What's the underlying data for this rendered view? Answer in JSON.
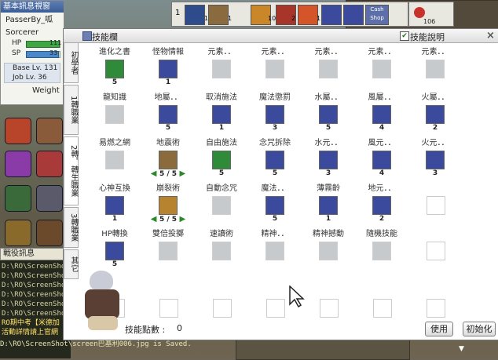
{
  "basic_window": {
    "title": "基本訊息視窗",
    "char_name": "PasserBy_呱",
    "job": "Sorcerer",
    "hp_label": "HP",
    "hp_value": "111",
    "hp_fraction": 0.97,
    "sp_label": "SP",
    "sp_value": "33",
    "sp_fraction": 0.95,
    "base_lv": "Base Lv. 131",
    "job_lv": "Job Lv. 36",
    "weight_label": "Weight :"
  },
  "hotbar": {
    "slot1_num": "1",
    "slot2_num": "1",
    "slot3_num": "10",
    "slot4_num": "2",
    "slot5_num": "1",
    "cash_shop_label": "Cash Shop",
    "potion_count": "106"
  },
  "chat": {
    "title": "戰役訊息",
    "lines": [
      "D:\\RO\\ScreenShot",
      "D:\\RO\\ScreenShot",
      "D:\\RO\\ScreenShot",
      "D:\\RO\\ScreenShot",
      "D:\\RO\\ScreenShot",
      "D:\\RO\\ScreenShot",
      "RO期中考【米德加",
      "活動詳情請上官網"
    ],
    "last_line": "D:\\RO\\ScreenShot\\screen巴基利006.jpg is Saved."
  },
  "skill_window": {
    "title": "技能欄",
    "desc_label": "技能說明",
    "close_label": "×",
    "tabs": [
      "初學者",
      "1轉職業",
      "2轉．轉生職業",
      "3轉職業",
      "其它"
    ],
    "rows": [
      [
        {
          "name": "進化之書",
          "lv": "5",
          "state": "learned",
          "color": "#2f8a3a"
        },
        {
          "name": "怪物情報",
          "lv": "1",
          "state": "learned",
          "color": "#3b4a9c"
        },
        {
          "name": "元素．．",
          "lv": "",
          "state": "locked",
          "color": "#9aa0a4"
        },
        {
          "name": "元素．．",
          "lv": "",
          "state": "locked",
          "color": "#9aa0a4"
        },
        {
          "name": "元素．．",
          "lv": "",
          "state": "locked",
          "color": "#9aa0a4"
        },
        {
          "name": "元素．．",
          "lv": "",
          "state": "locked",
          "color": "#9aa0a4"
        },
        {
          "name": "元素．．",
          "lv": "",
          "state": "locked",
          "color": "#9aa0a4"
        }
      ],
      [
        {
          "name": "龍知識",
          "lv": "",
          "state": "locked",
          "color": "#9aa0a4"
        },
        {
          "name": "地屬．．",
          "lv": "5",
          "state": "learned",
          "color": "#3b4a9c"
        },
        {
          "name": "取消施法",
          "lv": "1",
          "state": "learned",
          "color": "#3b4a9c"
        },
        {
          "name": "魔法懲罰",
          "lv": "3",
          "state": "learned",
          "color": "#3b4a9c"
        },
        {
          "name": "水屬．．",
          "lv": "5",
          "state": "learned",
          "color": "#3b4a9c"
        },
        {
          "name": "風屬．．",
          "lv": "4",
          "state": "learned",
          "color": "#3b4a9c"
        },
        {
          "name": "火屬．．",
          "lv": "2",
          "state": "learned",
          "color": "#3b4a9c"
        }
      ],
      [
        {
          "name": "易燃之網",
          "lv": "",
          "state": "locked",
          "color": "#9aa0a4"
        },
        {
          "name": "地震術",
          "lv": "5 / 5",
          "state": "stepper",
          "color": "#8b6a3c"
        },
        {
          "name": "自由施法",
          "lv": "5",
          "state": "learned",
          "color": "#2f8a3a"
        },
        {
          "name": "念咒拆除",
          "lv": "5",
          "state": "learned",
          "color": "#3b4a9c"
        },
        {
          "name": "水元．．",
          "lv": "3",
          "state": "learned",
          "color": "#3b4a9c"
        },
        {
          "name": "風元．．",
          "lv": "4",
          "state": "learned",
          "color": "#3b4a9c"
        },
        {
          "name": "火元．．",
          "lv": "3",
          "state": "learned",
          "color": "#3b4a9c"
        }
      ],
      [
        {
          "name": "心神互換",
          "lv": "1",
          "state": "learned",
          "color": "#3b4a9c"
        },
        {
          "name": "崩裂術",
          "lv": "5 / 5",
          "state": "stepper",
          "color": "#b8832e"
        },
        {
          "name": "自動念咒",
          "lv": "",
          "state": "locked",
          "color": "#9aa0a4"
        },
        {
          "name": "魔法．．",
          "lv": "5",
          "state": "learned",
          "color": "#3b4a9c"
        },
        {
          "name": "薄霧齡",
          "lv": "1",
          "state": "learned",
          "color": "#3b4a9c"
        },
        {
          "name": "地元．．",
          "lv": "2",
          "state": "learned",
          "color": "#3b4a9c"
        },
        {
          "name": "",
          "lv": "",
          "state": "empty",
          "color": ""
        }
      ],
      [
        {
          "name": "HP轉換",
          "lv": "5",
          "state": "learned",
          "color": "#3b4a9c"
        },
        {
          "name": "雙倍投擲",
          "lv": "",
          "state": "locked",
          "color": "#9aa0a4"
        },
        {
          "name": "速讀術",
          "lv": "",
          "state": "locked",
          "color": "#9aa0a4"
        },
        {
          "name": "精神．．",
          "lv": "",
          "state": "locked",
          "color": "#9aa0a4"
        },
        {
          "name": "精神撼動",
          "lv": "",
          "state": "locked",
          "color": "#9aa0a4"
        },
        {
          "name": "隨機技能",
          "lv": "",
          "state": "locked",
          "color": "#9aa0a4"
        },
        {
          "name": "",
          "lv": "",
          "state": "empty",
          "color": ""
        }
      ]
    ],
    "skill_points_label": "技能點數 :",
    "skill_points_value": "0",
    "use_button": "使用",
    "reset_button": "初始化"
  }
}
